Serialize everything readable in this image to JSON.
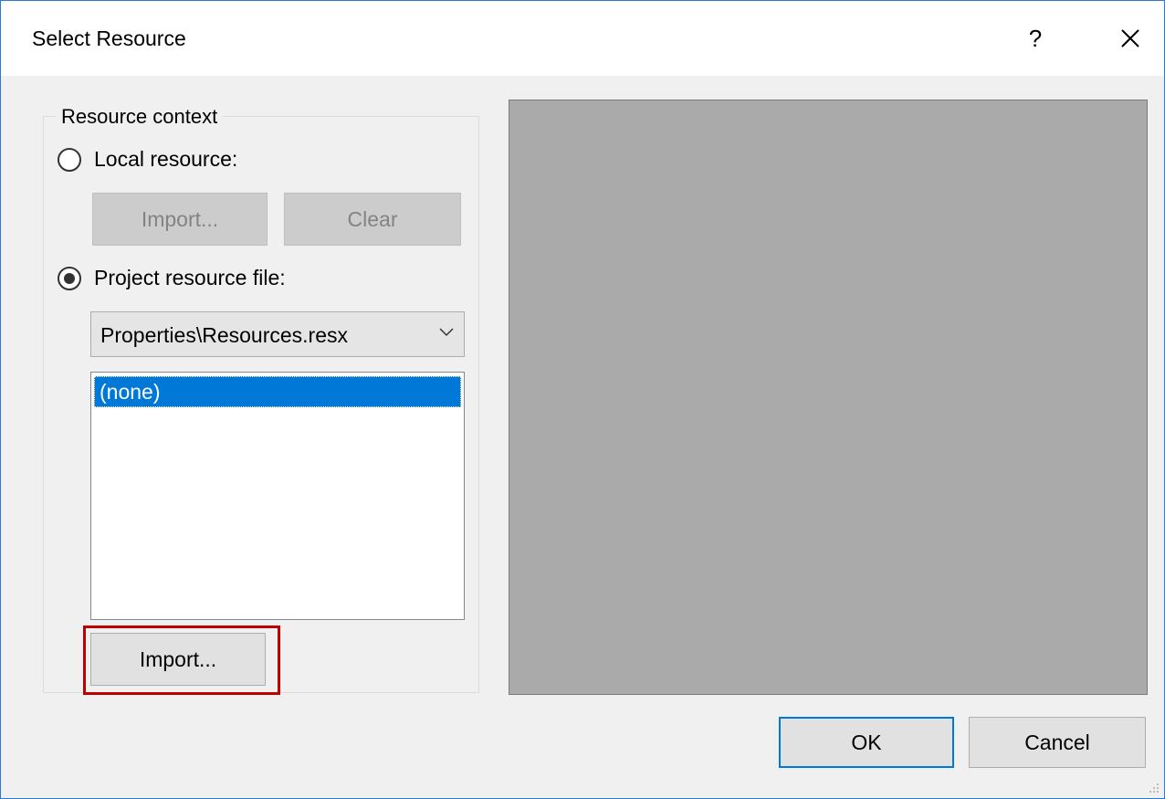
{
  "dialog": {
    "title": "Select Resource",
    "help_label": "?"
  },
  "resource_context": {
    "legend": "Resource context",
    "local_resource": {
      "label": "Local resource:",
      "selected": false,
      "import_label": "Import...",
      "clear_label": "Clear"
    },
    "project_resource": {
      "label": "Project resource file:",
      "selected": true,
      "file_select_value": "Properties\\Resources.resx",
      "list_items": [
        "(none)"
      ],
      "selected_item": "(none)",
      "import_label": "Import..."
    }
  },
  "footer": {
    "ok_label": "OK",
    "cancel_label": "Cancel"
  },
  "icons": {
    "close": "close-icon",
    "dropdown": "chevron-down-icon",
    "resize": "resize-grip-icon"
  },
  "colors": {
    "accent": "#0078d7",
    "highlight_border": "#c00000",
    "preview_bg": "#aaaaaa"
  }
}
